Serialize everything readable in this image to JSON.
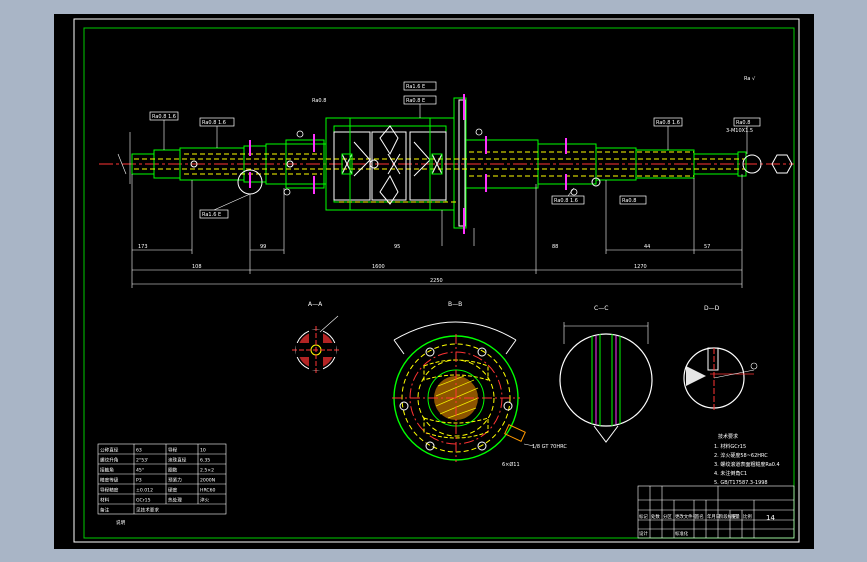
{
  "drawing": {
    "shaft_labels": {
      "left_callout": "Ra0.8 1.6",
      "left_callout2": "Ra0.8 1.6",
      "nut_callout_1": "Ra1.6 E",
      "nut_callout_2": "Ra0.8 E",
      "nut_label": "Ra0.8",
      "right_callout_1": "Ra0.8 1.6",
      "right_callout_2": "Ra0.8",
      "right_callout_3": "3-M10X1.5",
      "lower_callout_left": "Ra1.6 E",
      "lower_callout_mid": "Ra0.8 1.6",
      "lower_callout_right": "Ra0.8",
      "top_right_mark": "Ra √"
    },
    "dimensions": {
      "overall": "2250",
      "seg_left": "108",
      "seg_mid": "1600",
      "seg_right": "1270",
      "d1": "173",
      "d2": "99",
      "d3": "57",
      "d4": "44",
      "d5": "95",
      "d6": "88"
    },
    "section_views": {
      "aa_title": "A—A",
      "bb_title": "B—B",
      "view1_title": "C—C",
      "view2_title": "D—D",
      "bb_note": "1/8 GT 70HRC",
      "bb_hole_note": "6×Ø11"
    },
    "tech_requirements": {
      "heading": "技术要求",
      "items": [
        "1. 材料GCr15",
        "2. 淬火硬度58~62HRC",
        "3. 螺纹滚道表面粗糙度Ra0.4",
        "4. 未注倒角C1",
        "5. GB/T17587.3-1998"
      ]
    },
    "param_table": {
      "rows": [
        [
          "公称直径",
          "63",
          "导程",
          "10"
        ],
        [
          "螺纹升角",
          "2°53'",
          "滚珠直径",
          "6.35"
        ],
        [
          "接触角",
          "45°",
          "圈数",
          "2.5×2"
        ],
        [
          "精度等级",
          "P3",
          "预紧力",
          "2000N"
        ],
        [
          "导程精度",
          "±0.012",
          "硬度",
          "HRC60"
        ],
        [
          "材料",
          "GCr15",
          "热处理",
          "淬火"
        ],
        [
          "备注",
          "见技术要求",
          "",
          ""
        ]
      ],
      "footer": "说明"
    },
    "title_block": {
      "sheet": "14",
      "labels": [
        "标记",
        "处数",
        "分区",
        "更改文件号",
        "签名",
        "年月日"
      ],
      "bottom_labels": [
        "设计",
        "标准化",
        "阶段标记",
        "重量",
        "比例"
      ]
    }
  }
}
